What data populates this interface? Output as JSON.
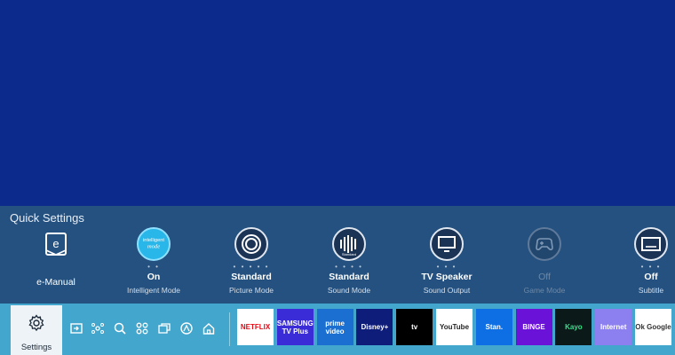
{
  "quick_settings": {
    "title": "Quick Settings",
    "items": [
      {
        "value": "e-Manual",
        "label": "",
        "icon": "book-icon"
      },
      {
        "value": "On",
        "label": "Intelligent Mode",
        "icon": "intelligent-mode-icon",
        "badge_line1": "intelligent",
        "badge_line2": "mode"
      },
      {
        "value": "Standard",
        "label": "Picture Mode",
        "icon": "picture-mode-icon"
      },
      {
        "value": "Standard",
        "label": "Sound Mode",
        "icon": "sound-mode-icon",
        "badge": "Standard"
      },
      {
        "value": "TV Speaker",
        "label": "Sound Output",
        "icon": "tv-speaker-icon"
      },
      {
        "value": "Off",
        "label": "Game Mode",
        "icon": "gamepad-icon"
      },
      {
        "value": "Off",
        "label": "Subtitle",
        "icon": "subtitle-icon"
      }
    ]
  },
  "bar": {
    "settings_label": "Settings",
    "nav_icons": [
      "source-icon",
      "connected-devices-icon",
      "search-icon",
      "apps-icon",
      "multi-view-icon",
      "ambient-icon",
      "home-icon"
    ],
    "apps": [
      {
        "name": "NETFLIX",
        "bg": "#ffffff",
        "fg": "#e50914"
      },
      {
        "name": "SAMSUNG TV Plus",
        "bg": "#3a2cd6",
        "fg": "#ffffff"
      },
      {
        "name": "prime video",
        "bg": "#1a6fd1",
        "fg": "#ffffff"
      },
      {
        "name": "Disney+",
        "bg": "#0f1d7a",
        "fg": "#ffffff"
      },
      {
        "name": "tv",
        "bg": "#000000",
        "fg": "#ffffff"
      },
      {
        "name": "YouTube",
        "bg": "#ffffff",
        "fg": "#222222"
      },
      {
        "name": "Stan.",
        "bg": "#0d6fe3",
        "fg": "#ffffff"
      },
      {
        "name": "BINGE",
        "bg": "#6b12d9",
        "fg": "#ffffff"
      },
      {
        "name": "Kayo",
        "bg": "#0b1a18",
        "fg": "#39e08c"
      },
      {
        "name": "Internet",
        "bg": "#8c7ff0",
        "fg": "#ffffff"
      },
      {
        "name": "Ok Google",
        "bg": "#ffffff",
        "fg": "#333333"
      }
    ]
  }
}
